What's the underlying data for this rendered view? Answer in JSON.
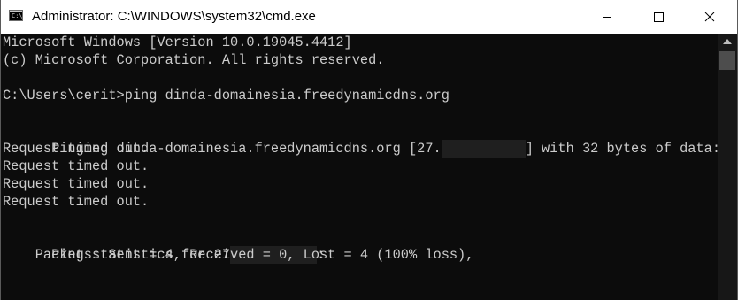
{
  "window": {
    "title": "Administrator: C:\\WINDOWS\\system32\\cmd.exe",
    "icon": "cmd-icon",
    "icon_prompt": "C:\\"
  },
  "controls": {
    "minimize_icon": "minimize-icon",
    "maximize_icon": "maximize-icon",
    "close_icon": "close-icon"
  },
  "console": {
    "text_color": "#cccccc",
    "background": "#0c0c0c",
    "lines": [
      "Microsoft Windows [Version 10.0.19045.4412]",
      "(c) Microsoft Corporation. All rights reserved.",
      "",
      "C:\\Users\\cerit>ping dinda-domainesia.freedynamicdns.org",
      "",
      "Pinging dinda-domainesia.freedynamicdns.org [27.",
      "] with 32 bytes of data:",
      "Request timed out.",
      "Request timed out.",
      "Request timed out.",
      "Request timed out.",
      "",
      "Ping statistics for 27",
      ":",
      "    Packets: Sent = 4, Received = 0, Lost = 4 (100% loss),"
    ]
  }
}
